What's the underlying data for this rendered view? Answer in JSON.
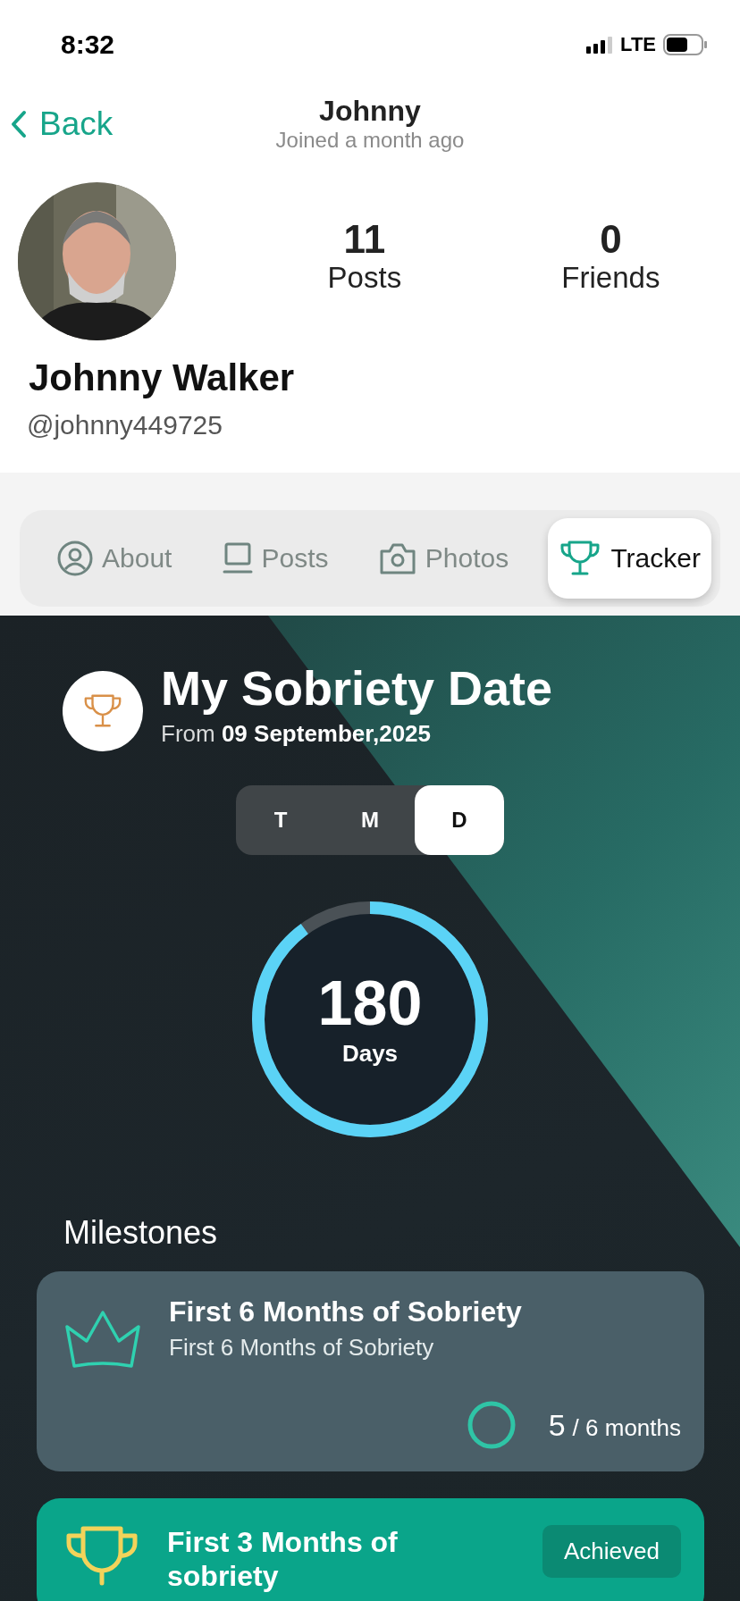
{
  "status_bar": {
    "time": "8:32",
    "network": "LTE"
  },
  "nav": {
    "back": "Back",
    "title": "Johnny",
    "subtitle": "Joined a month ago"
  },
  "profile": {
    "name": "Johnny Walker",
    "handle": "@johnny449725",
    "stats": [
      {
        "value": "11",
        "label": "Posts"
      },
      {
        "value": "0",
        "label": "Friends"
      }
    ]
  },
  "tabs": [
    {
      "kind": "about",
      "label": "About",
      "selected": false
    },
    {
      "kind": "posts",
      "label": "Posts",
      "selected": false
    },
    {
      "kind": "photos",
      "label": "Photos",
      "selected": false
    },
    {
      "kind": "tracker",
      "label": "Tracker",
      "selected": true
    }
  ],
  "tracker": {
    "title": "My Sobriety Date",
    "date_line": "From **09 September,2025**",
    "units": [
      {
        "label": "T",
        "selected": false
      },
      {
        "label": "M",
        "selected": false
      },
      {
        "label": "D",
        "selected": true
      }
    ],
    "counter": {
      "value": "180",
      "unit": "Days"
    }
  },
  "milestones": {
    "title": "Milestones",
    "items": [
      {
        "achieved": false,
        "title": "First 6 Months of Sobriety",
        "subtitle": "First 6 Months of Sobriety",
        "current": "5",
        "target": "/ 6 months"
      },
      {
        "achieved": true,
        "title": "First 3 Months of sobriety",
        "badge": "Achieved"
      }
    ]
  }
}
